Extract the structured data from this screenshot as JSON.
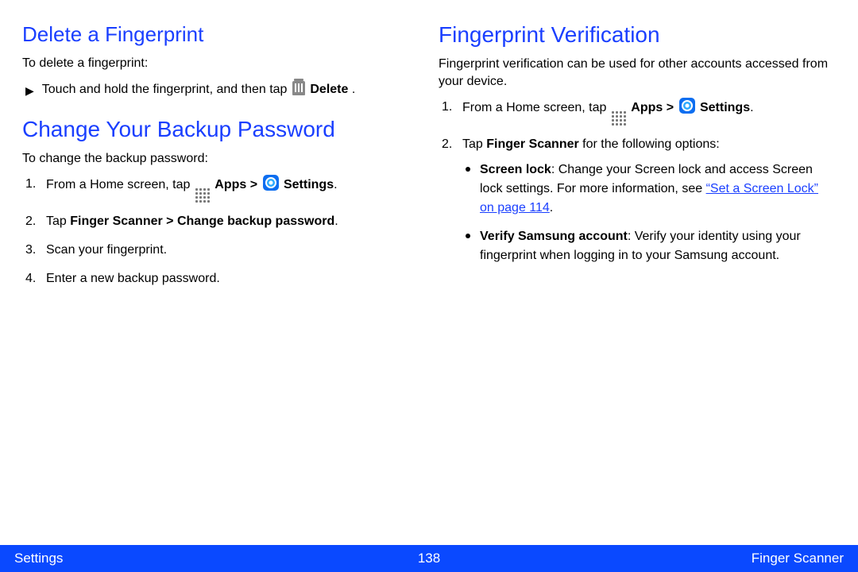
{
  "left": {
    "section1": {
      "heading": "Delete a Fingerprint",
      "intro": "To delete a fingerprint:",
      "step_pre": "Touch and hold the fingerprint, and then tap ",
      "step_bold": "Delete",
      "step_post": " ."
    },
    "section2": {
      "heading": "Change Your Backup Password",
      "intro": "To change the backup password:",
      "step1_pre": "From a Home screen, tap ",
      "step1_apps": "Apps",
      "step1_gt": " > ",
      "step1_settings": "Settings",
      "step1_post": ".",
      "step2_pre": "Tap ",
      "step2_bold": "Finger Scanner > Change backup password",
      "step2_post": ".",
      "step3": "Scan your fingerprint.",
      "step4": "Enter a new backup password."
    }
  },
  "right": {
    "heading": "Fingerprint Verification",
    "intro": "Fingerprint verification can be used for other accounts accessed from your device.",
    "step1_pre": "From a Home screen, tap ",
    "step1_apps": "Apps",
    "step1_gt": " > ",
    "step1_settings": "Settings",
    "step1_post": ".",
    "step2_pre": "Tap ",
    "step2_bold": "Finger Scanner",
    "step2_post": " for the following options:",
    "bullet1_bold": "Screen lock",
    "bullet1_body": ": Change your Screen lock and access Screen lock settings. For more information, see ",
    "bullet1_link": "“Set a Screen Lock” on page 114",
    "bullet1_post": ".",
    "bullet2_bold": "Verify Samsung account",
    "bullet2_body": ": Verify your identity using your fingerprint when logging in to your Samsung account."
  },
  "footer": {
    "left": "Settings",
    "center": "138",
    "right": "Finger Scanner"
  }
}
